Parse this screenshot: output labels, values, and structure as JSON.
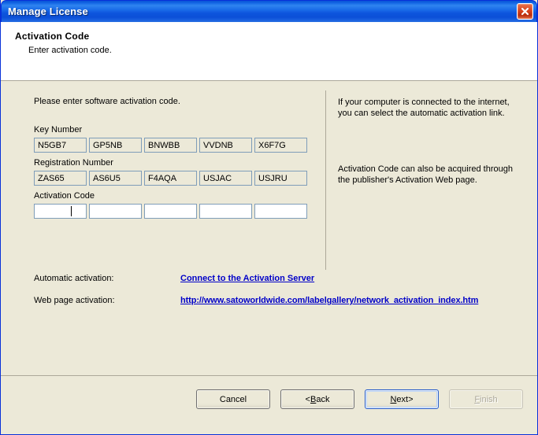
{
  "window": {
    "title": "Manage License",
    "close_icon": "close-icon"
  },
  "header": {
    "title": "Activation Code",
    "subtitle": "Enter activation code."
  },
  "main": {
    "intro": "Please enter software activation code.",
    "key_number": {
      "label": "Key Number",
      "values": [
        "N5GB7",
        "GP5NB",
        "BNWBB",
        "VVDNB",
        "X6F7G"
      ]
    },
    "registration_number": {
      "label": "Registration Number",
      "values": [
        "ZAS65",
        "AS6U5",
        "F4AQA",
        "USJAC",
        "USJRU"
      ]
    },
    "activation_code": {
      "label": "Activation Code",
      "values": [
        "",
        "",
        "",
        "",
        ""
      ],
      "placeholder": ""
    },
    "help": {
      "paragraph_1": "If your computer is connected to the internet, you can select the automatic activation link.",
      "paragraph_2": "Activation Code can also be acquired through the publisher's Activation Web page."
    },
    "links": {
      "automatic_caption": "Automatic activation:",
      "automatic_link": "Connect to the Activation Server",
      "webpage_caption": "Web page activation:",
      "webpage_link": "http://www.satoworldwide.com/labelgallery/network_activation_index.htm"
    }
  },
  "footer": {
    "cancel": "Cancel",
    "back_prefix": "< ",
    "back_acc": "B",
    "back_rest": "ack",
    "next_acc": "N",
    "next_rest": "ext",
    "next_suffix": " >",
    "finish_acc": "F",
    "finish_rest": "inish"
  },
  "colors": {
    "titlebar_blue": "#0a53d6",
    "dialog_face": "#ece9d8",
    "link_blue": "#0000c8",
    "close_red": "#d9431d",
    "field_border": "#7f9db9"
  }
}
